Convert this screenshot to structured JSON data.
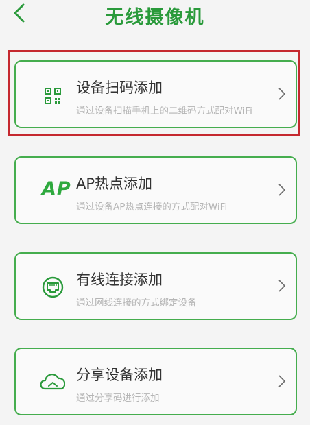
{
  "header": {
    "title": "无线摄像机",
    "back_icon": "chevron-left-icon"
  },
  "colors": {
    "accent": "#2a9a3b",
    "card_border": "#45ad4e",
    "highlight": "#c5282f",
    "desc_text": "#b5b5b5"
  },
  "options": [
    {
      "label": "设备扫码添加",
      "desc": "通过设备扫描手机上的二维码方式配对WiFi",
      "icon": "qr-code-icon",
      "highlighted": true
    },
    {
      "label": "AP热点添加",
      "desc": "通过设备AP热点连接的方式配对WiFi",
      "icon": "ap-icon",
      "icon_text": "AP"
    },
    {
      "label": "有线连接添加",
      "desc": "通过网线连接的方式绑定设备",
      "icon": "ethernet-icon"
    },
    {
      "label": "分享设备添加",
      "desc": "通过分享码进行添加",
      "icon": "share-icon"
    }
  ]
}
